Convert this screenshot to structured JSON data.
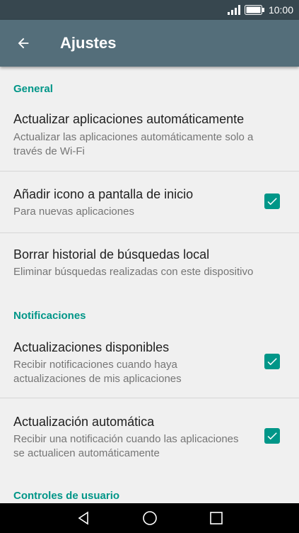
{
  "status_bar": {
    "time": "10:00",
    "signal_icon": "signal-icon",
    "battery_icon": "battery-icon"
  },
  "app_bar": {
    "title": "Ajustes",
    "back_icon": "arrow-back-icon"
  },
  "sections": [
    {
      "header": "General"
    },
    {
      "header": "Notificaciones"
    },
    {
      "header": "Controles de usuario"
    }
  ],
  "settings": [
    {
      "title": "Actualizar aplicaciones automáticamente",
      "subtitle": "Actualizar las aplicaciones automáticamente solo a través de Wi-Fi",
      "checked": null
    },
    {
      "title": "Añadir icono a pantalla de inicio",
      "subtitle": "Para nuevas aplicaciones",
      "checked": true
    },
    {
      "title": "Borrar historial de búsquedas  local",
      "subtitle": "Eliminar búsquedas realizadas con este dispositivo",
      "checked": null
    },
    {
      "title": "Actualizaciones disponibles",
      "subtitle": "Recibir notificaciones cuando haya actualizaciones de mis aplicaciones",
      "checked": true
    },
    {
      "title": "Actualización automática",
      "subtitle": "Recibir una notificación cuando las aplicaciones se actualicen automáticamente",
      "checked": true
    }
  ],
  "nav_bar": {
    "back_icon": "nav-back-icon",
    "home_icon": "nav-home-icon",
    "recents_icon": "nav-recents-icon"
  },
  "colors": {
    "accent": "#009688",
    "app_bar": "#546e7a",
    "status_bar": "#37474f"
  }
}
